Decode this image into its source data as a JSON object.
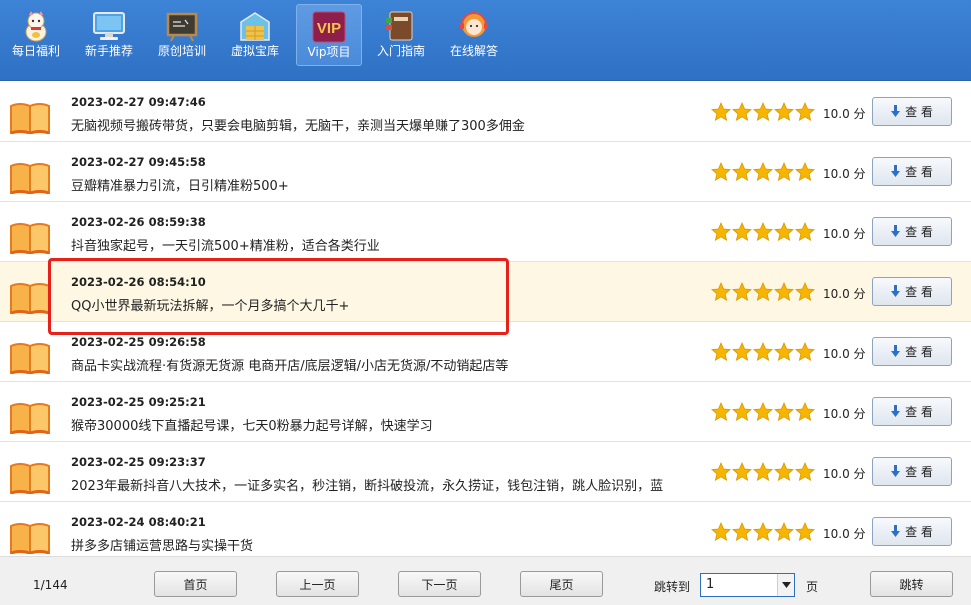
{
  "nav": [
    {
      "label": "每日福利",
      "icon": "lucky-cat-icon"
    },
    {
      "label": "新手推荐",
      "icon": "monitor-icon"
    },
    {
      "label": "原创培训",
      "icon": "blackboard-icon"
    },
    {
      "label": "虚拟宝库",
      "icon": "warehouse-icon"
    },
    {
      "label": "Vip项目",
      "icon": "vip-icon",
      "badge": "VIP"
    },
    {
      "label": "入门指南",
      "icon": "guide-book-icon"
    },
    {
      "label": "在线解答",
      "icon": "support-agent-icon"
    }
  ],
  "list": {
    "view_label": "查 看",
    "score_unit": "分",
    "items": [
      {
        "time": "2023-02-27 09:47:46",
        "title": "无脑视频号搬砖带货，只要会电脑剪辑，无脑干，亲测当天爆单赚了300多佣金",
        "score": "10.0",
        "stars": 5
      },
      {
        "time": "2023-02-27 09:45:58",
        "title": "豆瓣精准暴力引流，日引精准粉500+",
        "score": "10.0",
        "stars": 5
      },
      {
        "time": "2023-02-26 08:59:38",
        "title": "抖音独家起号，一天引流500+精准粉，适合各类行业",
        "score": "10.0",
        "stars": 5
      },
      {
        "time": "2023-02-26 08:54:10",
        "title": "QQ小世界最新玩法拆解，一个月多搞个大几千+",
        "score": "10.0",
        "stars": 5
      },
      {
        "time": "2023-02-25 09:26:58",
        "title": "商品卡实战流程·有货源无货源 电商开店/底层逻辑/小店无货源/不动销起店等",
        "score": "10.0",
        "stars": 5
      },
      {
        "time": "2023-02-25 09:25:21",
        "title": "猴帝30000线下直播起号课，七天0粉暴力起号详解，快速学习",
        "score": "10.0",
        "stars": 5
      },
      {
        "time": "2023-02-25 09:23:37",
        "title": "2023年最新抖音八大技术，一证多实名，秒注销，断抖破投流，永久捞证，钱包注销，跳人脸识别，蓝",
        "score": "10.0",
        "stars": 5
      },
      {
        "time": "2023-02-24 08:40:21",
        "title": "拼多多店铺运营思路与实操干货",
        "score": "10.0",
        "stars": 5
      }
    ]
  },
  "footer": {
    "page_info": "1/144",
    "first": "首页",
    "prev": "上一页",
    "next": "下一页",
    "last": "尾页",
    "jump_label": "跳转到",
    "jump_value": "1",
    "page_unit": "页",
    "jump_button": "跳转"
  },
  "colors": {
    "accent": "#3479cc",
    "highlight": "#e5211a",
    "star": "#f7b500"
  }
}
